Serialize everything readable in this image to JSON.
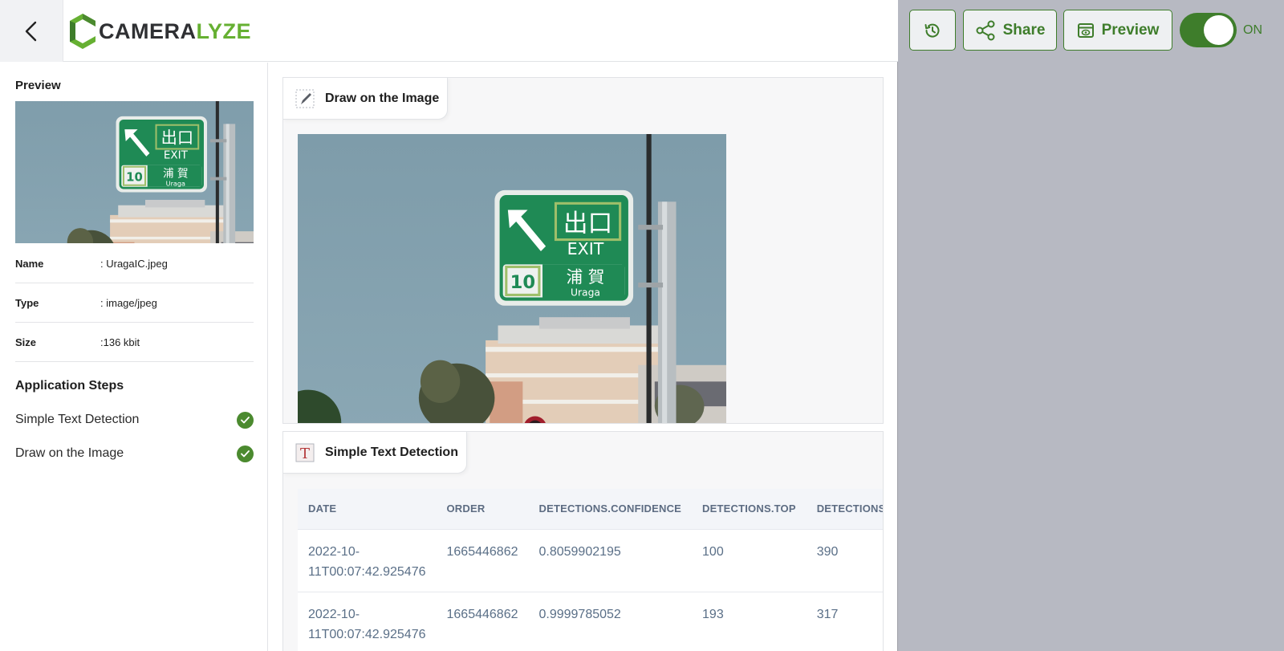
{
  "app": {
    "logo_text_a": "CAMERA",
    "logo_text_b": "LYZE"
  },
  "header": {
    "share_label": "Share",
    "preview_label": "Preview",
    "toggle_label": "ON",
    "toggle_state": true,
    "accent_color": "#3e7d2b"
  },
  "sidebar": {
    "preview_title": "Preview",
    "file_info": [
      {
        "key": "Name",
        "value": ": UragaIC.jpeg"
      },
      {
        "key": "Type",
        "value": ": image/jpeg"
      },
      {
        "key": "Size",
        "value": ":136 kbit"
      }
    ],
    "steps_title": "Application Steps",
    "steps": [
      {
        "label": "Simple Text Detection",
        "status": "completed"
      },
      {
        "label": "Draw on the Image",
        "status": "completed"
      }
    ]
  },
  "draw_card": {
    "title": "Draw on the Image"
  },
  "image_sign": {
    "line1": "出口",
    "line2": "EXIT",
    "route": "10",
    "kanji": "浦 賀",
    "romaji": "Uraga"
  },
  "text_card": {
    "title": "Simple Text Detection",
    "columns": [
      "DATE",
      "ORDER",
      "DETECTIONS.CONFIDENCE",
      "DETECTIONS.TOP",
      "DETECTIONS.LE"
    ],
    "rows": [
      [
        "2022-10-11T00:07:42.925476",
        "1665446862",
        "0.8059902195",
        "100",
        "390"
      ],
      [
        "2022-10-11T00:07:42.925476",
        "1665446862",
        "0.9999785052",
        "193",
        "317"
      ]
    ]
  }
}
